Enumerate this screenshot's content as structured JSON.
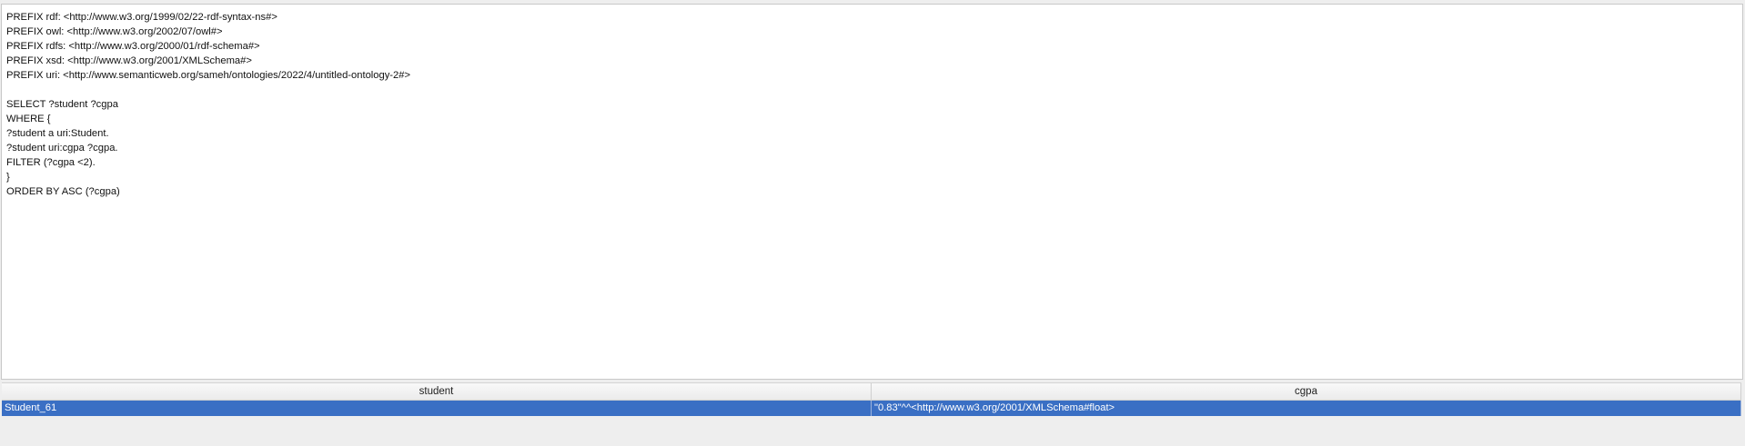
{
  "query": {
    "lines": [
      "PREFIX rdf: <http://www.w3.org/1999/02/22-rdf-syntax-ns#>",
      "PREFIX owl: <http://www.w3.org/2002/07/owl#>",
      "PREFIX rdfs: <http://www.w3.org/2000/01/rdf-schema#>",
      "PREFIX xsd: <http://www.w3.org/2001/XMLSchema#>",
      "PREFIX uri: <http://www.semanticweb.org/sameh/ontologies/2022/4/untitled-ontology-2#>",
      "",
      "SELECT ?student ?cgpa",
      "WHERE {",
      "?student a uri:Student.",
      "?student uri:cgpa ?cgpa.",
      "FILTER (?cgpa <2).",
      "}",
      "ORDER BY ASC (?cgpa)"
    ]
  },
  "results": {
    "columns": [
      "student",
      "cgpa"
    ],
    "rows": [
      [
        "Student_61",
        "\"0.83\"^^<http://www.w3.org/2001/XMLSchema#float>"
      ]
    ],
    "selected_row_color": "#3a6fc4"
  }
}
